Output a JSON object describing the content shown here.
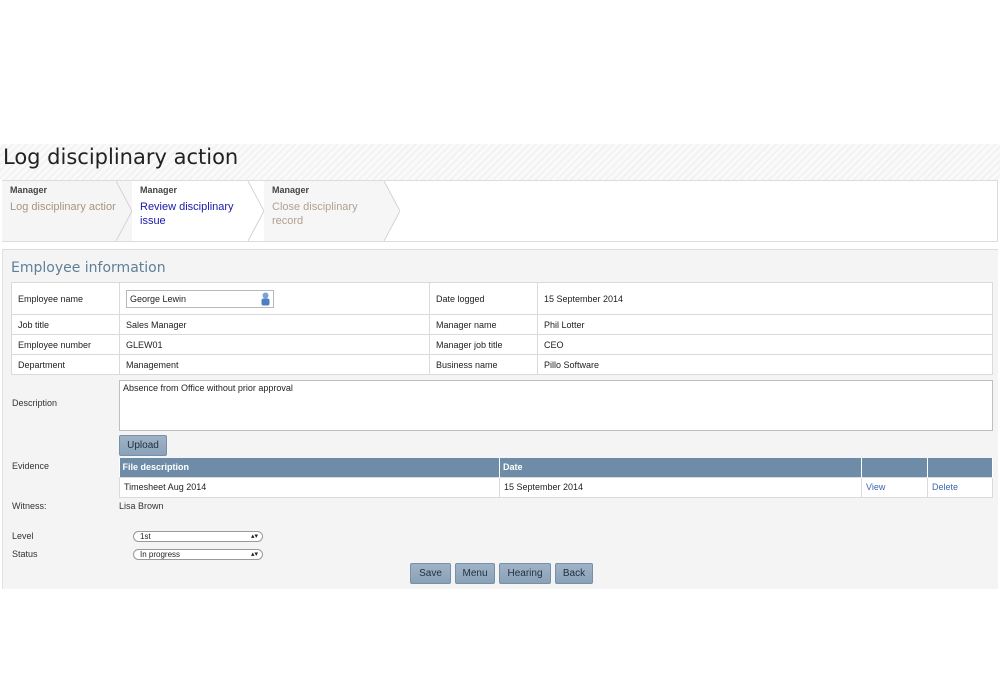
{
  "page": {
    "title": "Log disciplinary action"
  },
  "steps": [
    {
      "role": "Manager",
      "name": "Log disciplinary action"
    },
    {
      "role": "Manager",
      "name_line1": "Review disciplinary",
      "name_line2": "issue"
    },
    {
      "role": "Manager",
      "name_line1": "Close disciplinary",
      "name_line2": "record"
    }
  ],
  "section": {
    "title": "Employee information"
  },
  "employee": {
    "name_label": "Employee name",
    "name_value": "George Lewin",
    "job_title_label": "Job title",
    "job_title_value": "Sales Manager",
    "number_label": "Employee number",
    "number_value": "GLEW01",
    "department_label": "Department",
    "department_value": "Management",
    "date_logged_label": "Date logged",
    "date_logged_value": "15 September 2014",
    "manager_name_label": "Manager name",
    "manager_name_value": "Phil Lotter",
    "manager_job_title_label": "Manager job title",
    "manager_job_title_value": "CEO",
    "business_name_label": "Business name",
    "business_name_value": "Pillo Software"
  },
  "description": {
    "label": "Description",
    "value": "Absence from Office without prior approval"
  },
  "evidence": {
    "label": "Evidence",
    "upload_label": "Upload",
    "columns": [
      "File description",
      "Date",
      "",
      ""
    ],
    "rows": [
      {
        "file": "Timesheet Aug 2014",
        "date": "15 September 2014",
        "view": "View",
        "delete": "Delete"
      }
    ]
  },
  "witness": {
    "label": "Witness:",
    "value": "Lisa Brown"
  },
  "level": {
    "label": "Level",
    "value": "1st"
  },
  "status": {
    "label": "Status",
    "value": "In progress"
  },
  "buttons": {
    "save": "Save",
    "menu": "Menu",
    "hearing": "Hearing",
    "back": "Back"
  },
  "colors": {
    "accent": "#6e8ca8",
    "button": "#8aa1b7",
    "link": "#3a66b0"
  }
}
